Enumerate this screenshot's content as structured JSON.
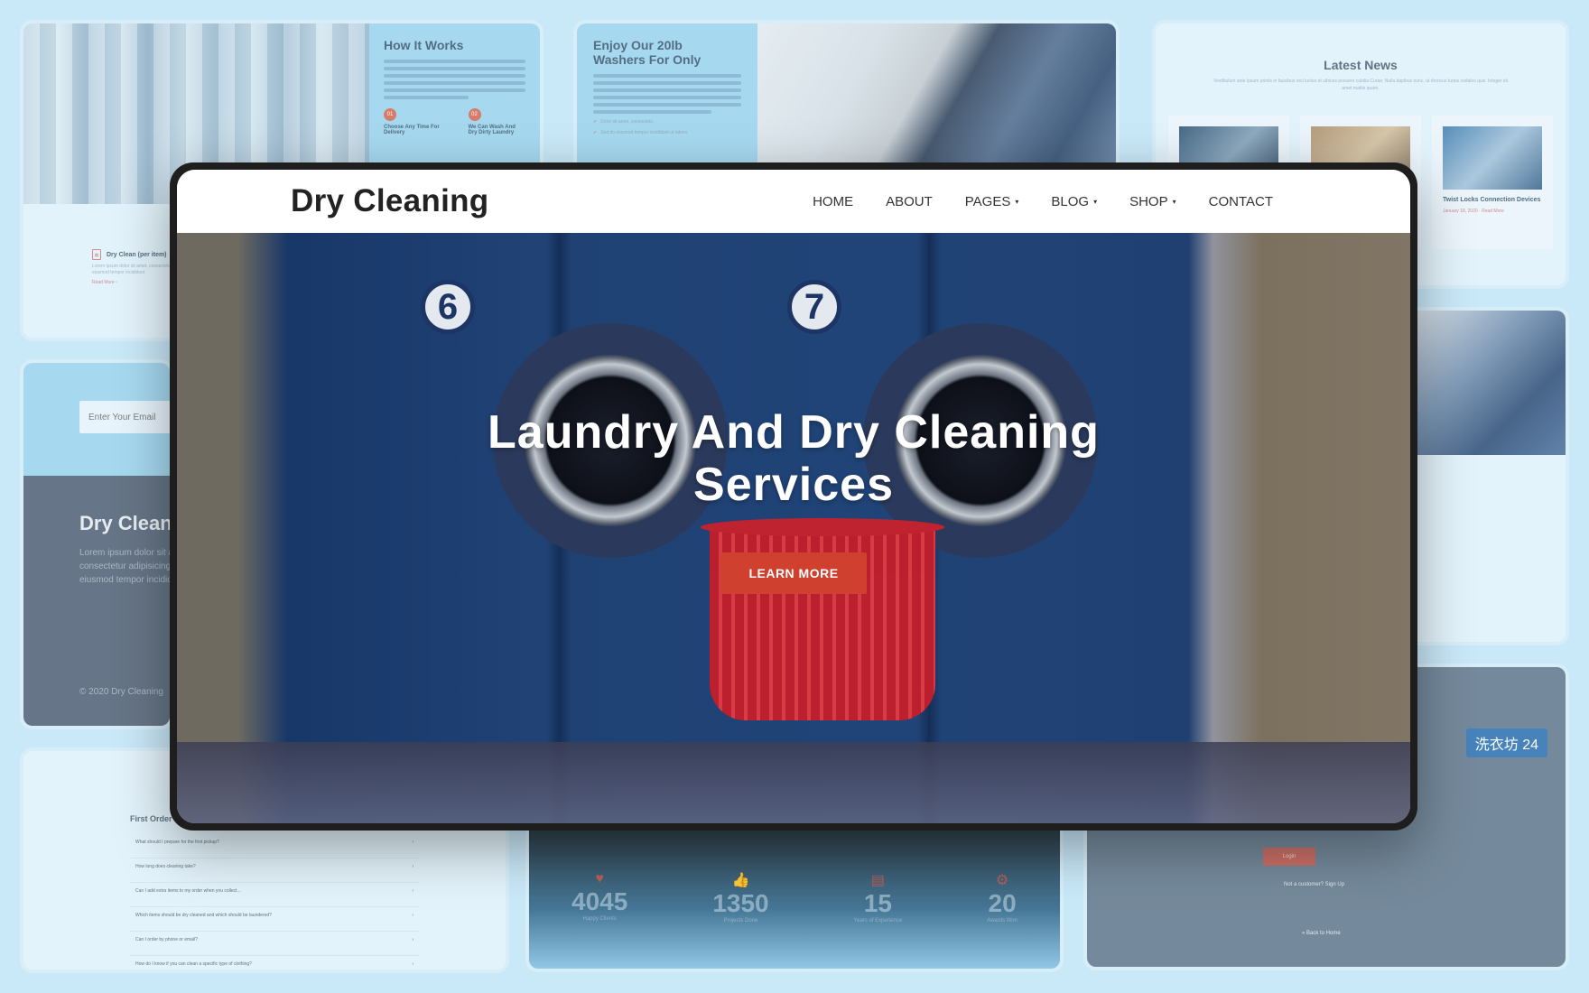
{
  "main": {
    "brand": "Dry Cleaning",
    "nav": [
      {
        "label": "HOME",
        "has_dropdown": false
      },
      {
        "label": "ABOUT",
        "has_dropdown": false
      },
      {
        "label": "PAGES",
        "has_dropdown": true
      },
      {
        "label": "BLOG",
        "has_dropdown": true
      },
      {
        "label": "SHOP",
        "has_dropdown": true
      },
      {
        "label": "CONTACT",
        "has_dropdown": false
      }
    ],
    "caret": "▾",
    "hero": {
      "title_line1": "Laundry And Dry Cleaning",
      "title_line2": "Services",
      "cta_label": "LEARN MORE",
      "badge_left": "6",
      "badge_right": "7"
    },
    "accent_color": "#d0402f"
  },
  "how_it_works": {
    "title": "How It Works",
    "steps": [
      {
        "num": "01",
        "label": "Choose Any Time For Delivery"
      },
      {
        "num": "02",
        "label": "We Can Wash And Dry Dirty Laundry"
      }
    ],
    "service": {
      "title": "Dry Clean (per item)",
      "text": "Lorem ipsum dolor sit amet, consectetur adipisicingelit, sed do eiusmod tempor incididunt",
      "read_more": "Read More ›"
    }
  },
  "enjoy": {
    "title_line1": "Enjoy Our 20lb",
    "title_line2": "Washers For Only",
    "checks": [
      "Dolor sit amet, consectetu",
      "Sed do eiusmod tempor incididunt ut labore"
    ]
  },
  "news": {
    "title": "Latest News",
    "subtitle": "Vestibulum ante ipsum primis in faucibus orci luctus et ultrices posuere cubilia Curae; Nulla dapibus nunc, ut rhoncus turpis sodales quis. Integer sit amet mattis quam.",
    "items": [
      {
        "title": "",
        "meta": ""
      },
      {
        "title": "",
        "meta": ""
      },
      {
        "title": "Twist Locks Connection Devices",
        "meta": "January 18, 2020  ·  Read More"
      }
    ]
  },
  "footer": {
    "email_placeholder": "Enter Your Email",
    "brand": "Dry Cleaning",
    "text_line1": "Lorem ipsum dolor sit amet,",
    "text_line2": "consectetur adipisicing elit, sed do",
    "text_line3": "eiusmod tempor incididunt",
    "copyright": "© 2020 Dry Cleaning"
  },
  "faq": {
    "title": "First Order",
    "questions": [
      "What should I prepare for the first pickup?",
      "How long does cleaning take?",
      "Can I add extra items to my order when you collect...",
      "Which items should be dry cleaned and which should be laundered?",
      "Can I order by phone or email?",
      "How do I know if you can clean a specific type of clothing?"
    ]
  },
  "counters": [
    {
      "icon": "heart-icon",
      "glyph": "♥",
      "value": "4045",
      "label": "Happy Clients"
    },
    {
      "icon": "thumbs-up-icon",
      "glyph": "👍",
      "value": "1350",
      "label": "Projects Done"
    },
    {
      "icon": "id-card-icon",
      "glyph": "▤",
      "value": "15",
      "label": "Years of Experience"
    },
    {
      "icon": "gear-icon",
      "glyph": "⚙",
      "value": "20",
      "label": "Awards Won"
    }
  ],
  "login": {
    "button": "Login",
    "signup": "Not a customer? Sign Up",
    "back_home": "« Back to Home",
    "sign": "洗衣坊 24"
  }
}
